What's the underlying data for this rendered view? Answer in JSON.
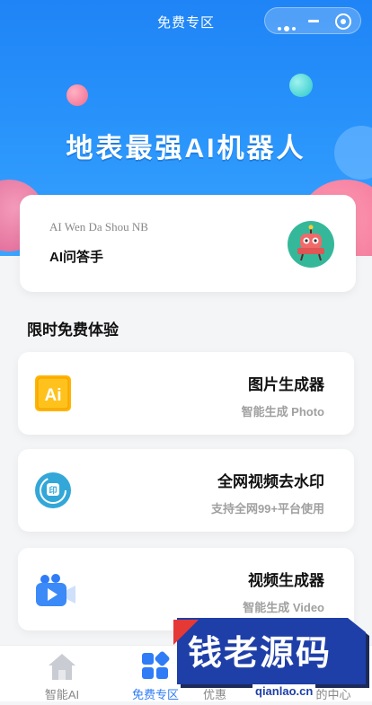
{
  "nav": {
    "title": "免费专区"
  },
  "banner": {
    "headline": "地表最强AI机器人"
  },
  "ai_card": {
    "subtitle": "AI Wen Da Shou NB",
    "title": "AI问答手"
  },
  "section": {
    "title": "限时免费体验"
  },
  "tools": [
    {
      "name": "图片生成器",
      "desc": "智能生成 Photo",
      "icon": "ai-icon"
    },
    {
      "name": "全网视频去水印",
      "desc": "支持全网99+平台使用",
      "icon": "video-watermark-icon"
    },
    {
      "name": "视频生成器",
      "desc": "智能生成 Video",
      "icon": "video-camera-icon"
    }
  ],
  "tabs": [
    {
      "label": "智能AI",
      "icon": "home-icon"
    },
    {
      "label": "免费专区",
      "icon": "grid-icon"
    },
    {
      "label": "优惠",
      "icon": ""
    },
    {
      "label": "的中心",
      "icon": ""
    }
  ],
  "watermark": {
    "text": "钱老源码",
    "url": "qianlao.cn"
  },
  "colors": {
    "primary": "#2f7cf6",
    "banner": "#1f84f6"
  }
}
